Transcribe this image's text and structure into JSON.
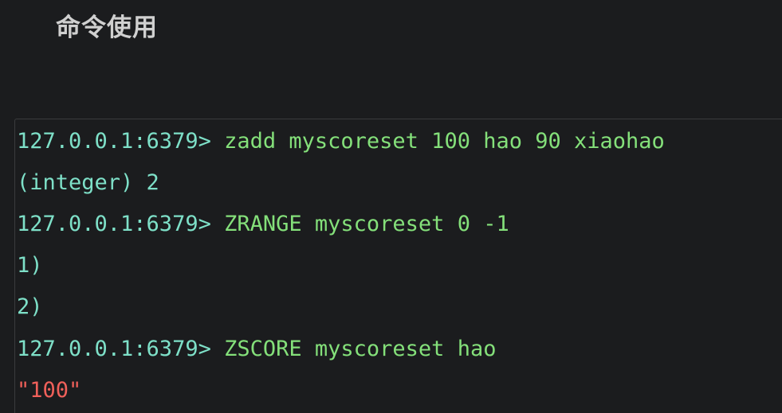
{
  "heading": "命令使用",
  "terminal": {
    "lines": [
      {
        "prompt": "127.0.0.1:6379>",
        "command": " zadd myscoreset 100 hao 90 xiaohao"
      },
      {
        "output": "(integer) 2"
      },
      {
        "prompt": "127.0.0.1:6379>",
        "command": " ZRANGE myscoreset 0 -1"
      },
      {
        "output": "1)"
      },
      {
        "output": "2)"
      },
      {
        "prompt": "127.0.0.1:6379>",
        "command": " ZSCORE myscoreset hao"
      },
      {
        "string_output": "\"100\""
      }
    ]
  },
  "colors": {
    "background": "#1b1c1e",
    "prompt": "#7ee0c8",
    "command": "#84e07a",
    "string": "#f0605a"
  }
}
